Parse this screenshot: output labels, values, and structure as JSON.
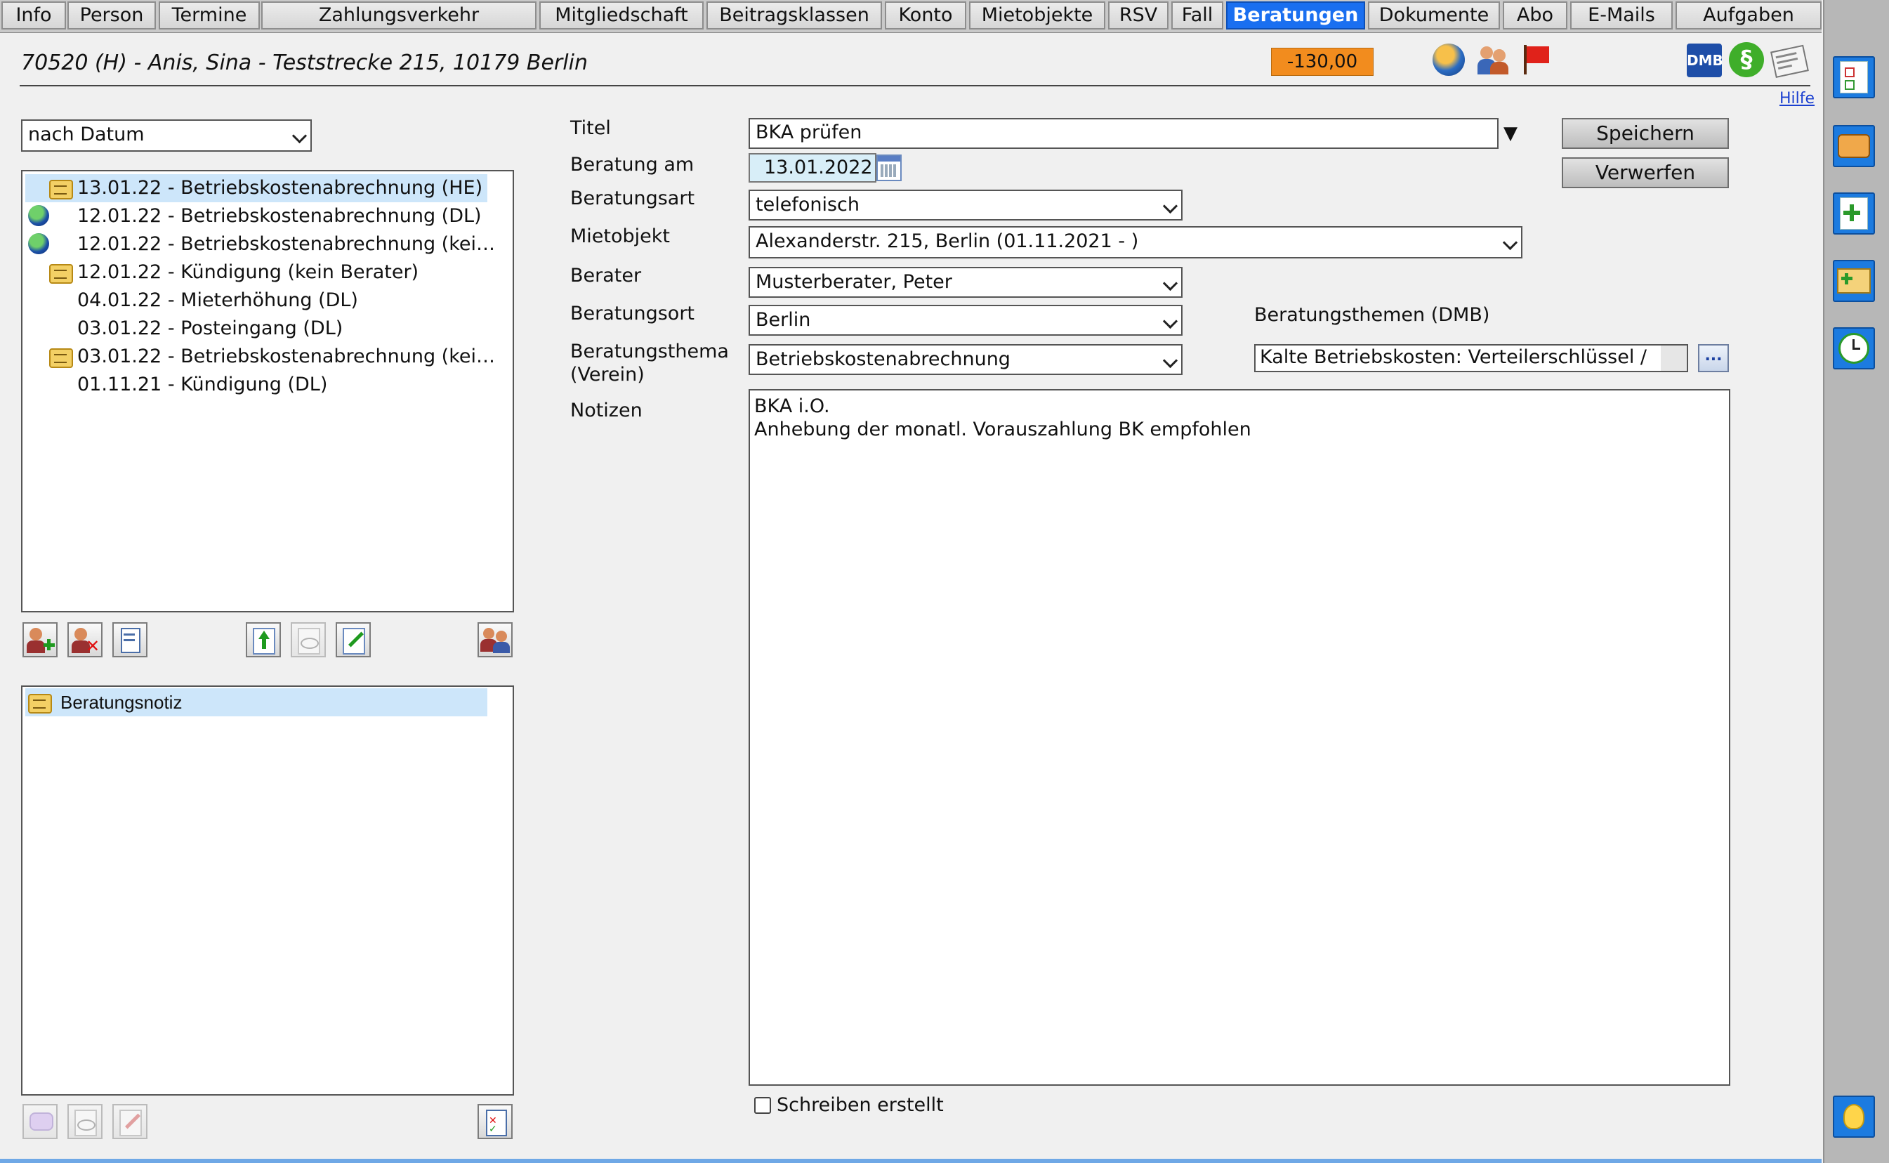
{
  "tabs": [
    {
      "label": "Info"
    },
    {
      "label": "Person"
    },
    {
      "label": "Termine"
    },
    {
      "label": "Zahlungsverkehr"
    },
    {
      "label": "Mitgliedschaft"
    },
    {
      "label": "Beitragsklassen"
    },
    {
      "label": "Konto"
    },
    {
      "label": "Mietobjekte"
    },
    {
      "label": "RSV"
    },
    {
      "label": "Fall"
    },
    {
      "label": "Beratungen",
      "active": true
    },
    {
      "label": "Dokumente"
    },
    {
      "label": "Abo"
    },
    {
      "label": "E-Mails"
    },
    {
      "label": "Aufgaben"
    }
  ],
  "header": {
    "member": "70520 (H) - Anis, Sina - Teststrecke 215, 10179 Berlin",
    "balance": "-130,00",
    "balance_color": "#f28c1e",
    "hilfe": "Hilfe",
    "status_icons": [
      "globe-person-icon",
      "people-icon",
      "red-flag-icon"
    ],
    "tool_icons": [
      "dmb-logo-icon",
      "paragraph-icon",
      "newspaper-icon"
    ],
    "dmb_text": "DMB",
    "paragraph_symbol": "§"
  },
  "left": {
    "sort": {
      "value": "nach Datum"
    },
    "consultations": [
      {
        "text": "13.01.22 - Betriebskostenabrechnung (HE)",
        "icon": "note",
        "selected": true
      },
      {
        "text": "12.01.22 - Betriebskostenabrechnung (DL)",
        "icon": "globe"
      },
      {
        "text": "12.01.22 - Betriebskostenabrechnung (kei…",
        "icon": "globe"
      },
      {
        "text": "12.01.22 - Kündigung (kein Berater)",
        "icon": "note"
      },
      {
        "text": "04.01.22 - Mieterhöhung (DL)",
        "icon": ""
      },
      {
        "text": "03.01.22 - Posteingang (DL)",
        "icon": ""
      },
      {
        "text": "03.01.22 - Betriebskostenabrechnung (kei…",
        "icon": "note"
      },
      {
        "text": "01.11.21 - Kündigung (DL)",
        "icon": ""
      }
    ],
    "toolbar_icons": [
      "add-consultation-icon",
      "delete-consultation-icon",
      "print-list-icon",
      "export-icon",
      "view-icon",
      "edit-icon",
      "transfer-consultant-icon"
    ],
    "notes_list": [
      {
        "text": "Beratungsnotiz",
        "selected": true
      }
    ],
    "notes_toolbar_icons": [
      "add-note-icon",
      "view-note-icon",
      "edit-note-icon",
      "task-checklist-icon"
    ]
  },
  "form": {
    "labels": {
      "titel": "Titel",
      "beratung_am": "Beratung am",
      "beratungsart": "Beratungsart",
      "mietobjekt": "Mietobjekt",
      "berater": "Berater",
      "beratungsort": "Beratungsort",
      "beratungsthema": "Beratungsthema",
      "beratungsthema2": "(Verein)",
      "notizen": "Notizen",
      "themen_dmb": "Beratungsthemen (DMB)"
    },
    "titel": "BKA prüfen",
    "datum": "13.01.2022",
    "beratungsart": "telefonisch",
    "mietobjekt": "Alexanderstr. 215, Berlin (01.11.2021 - )",
    "berater": "Musterberater, Peter",
    "beratungsort": "Berlin",
    "beratungsthema": "Betriebskostenabrechnung",
    "themen_dmb": "Kalte Betriebskosten: Verteilerschlüssel /",
    "themen_dmb_button": "...",
    "notizen": "BKA i.O.\nAnhebung der monatl. Vorauszahlung BK empfohlen",
    "schreiben_label": "Schreiben erstellt",
    "schreiben_checked": false,
    "save": "Speichern",
    "discard": "Verwerfen"
  },
  "rightbar_icons": [
    "task-list-icon",
    "phone-icon",
    "add-document-icon",
    "add-mail-icon",
    "clock-icon",
    "lightbulb-icon"
  ]
}
